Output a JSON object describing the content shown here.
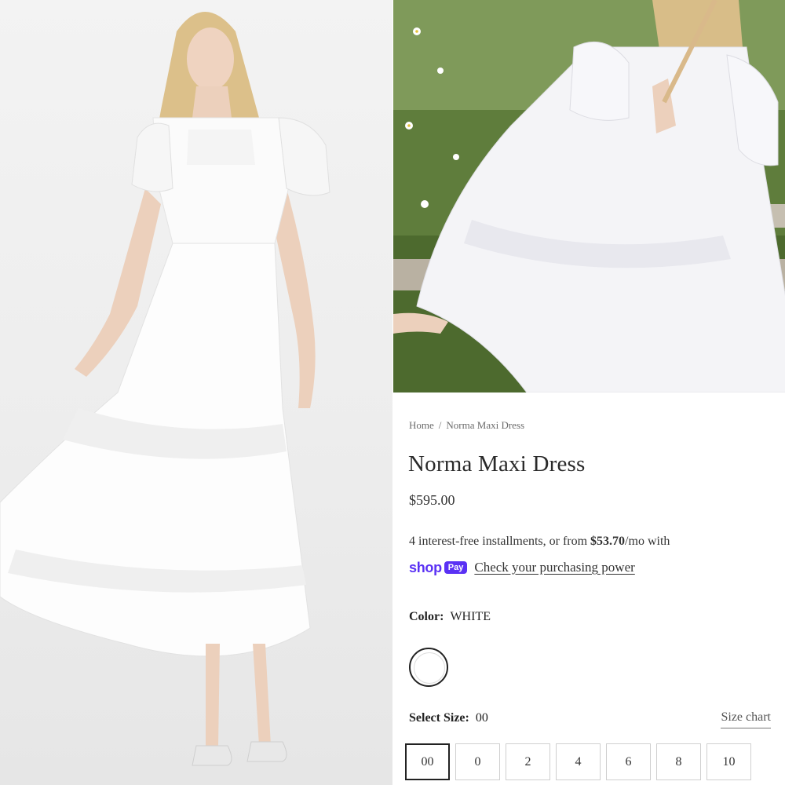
{
  "breadcrumb": {
    "home": "Home",
    "separator": "/",
    "current": "Norma Maxi Dress"
  },
  "product": {
    "title": "Norma Maxi Dress",
    "price": "$595.00"
  },
  "installments": {
    "text_before": "4 interest-free installments, or from ",
    "amount": "$53.70",
    "text_after": "/mo with"
  },
  "shop_pay": {
    "shop": "shop",
    "pay": "Pay",
    "link": "Check your purchasing power",
    "brand_color": "#5a31f4"
  },
  "color": {
    "label": "Color:",
    "value": "WHITE",
    "swatch_color": "#ffffff"
  },
  "size": {
    "label": "Select Size:",
    "value": "00",
    "chart_link": "Size chart",
    "options": [
      "00",
      "0",
      "2",
      "4",
      "6",
      "8",
      "10"
    ],
    "selected": "00"
  }
}
